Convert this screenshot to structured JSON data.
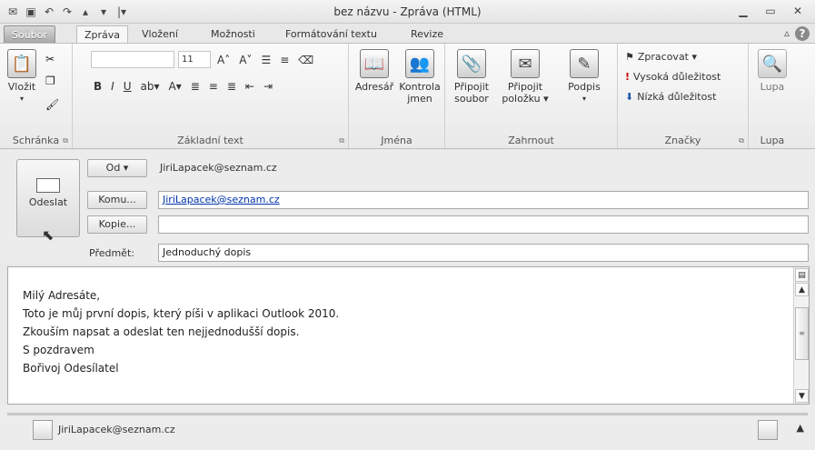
{
  "window": {
    "title": "bez názvu - Zpráva (HTML)",
    "controls": [
      "minimize-icon",
      "restore-icon",
      "close-icon"
    ]
  },
  "tabs": [
    {
      "label": "Soubor"
    },
    {
      "label": "Zpráva"
    },
    {
      "label": "Vložení"
    },
    {
      "label": "Možnosti"
    },
    {
      "label": "Formátování textu"
    },
    {
      "label": "Revize"
    }
  ],
  "ribbon": {
    "clipboard": {
      "paste": "Vložit",
      "group": "Schránka"
    },
    "basic_text": {
      "font_size": "11",
      "group": "Základní text"
    },
    "names": {
      "address_book": "Adresář",
      "check_names_1": "Kontrola",
      "check_names_2": "jmen",
      "group": "Jména"
    },
    "include": {
      "attach_file_1": "Připojit",
      "attach_file_2": "soubor",
      "attach_item_1": "Připojit",
      "attach_item_2": "položku ▾",
      "signature": "Podpis",
      "group": "Zahrnout"
    },
    "tags": {
      "follow_up": "Zpracovat ▾",
      "high_importance": "Vysoká důležitost",
      "low_importance": "Nízká důležitost",
      "group": "Značky"
    },
    "zoom": {
      "zoom": "Lupa",
      "group": "Lupa"
    }
  },
  "header": {
    "send_label": "Odeslat",
    "from_button": "Od ▾",
    "from_value": "JiriLapacek@seznam.cz",
    "to_button": "Komu...",
    "to_value": "JiriLapacek@seznam.cz",
    "cc_button": "Kopie...",
    "cc_value": "",
    "subject_label": "Předmět:",
    "subject_value": "Jednoduchý dopis"
  },
  "body": {
    "lines": [
      "Milý Adresáte,",
      "Toto je můj první dopis, který píši v aplikaci Outlook 2010.",
      "Zkouším napsat a odeslat ten nejjednodušší dopis.",
      "S pozdravem",
      "Bořivoj Odesílatel"
    ]
  },
  "people_pane": {
    "contact": "JiriLapacek@seznam.cz"
  }
}
